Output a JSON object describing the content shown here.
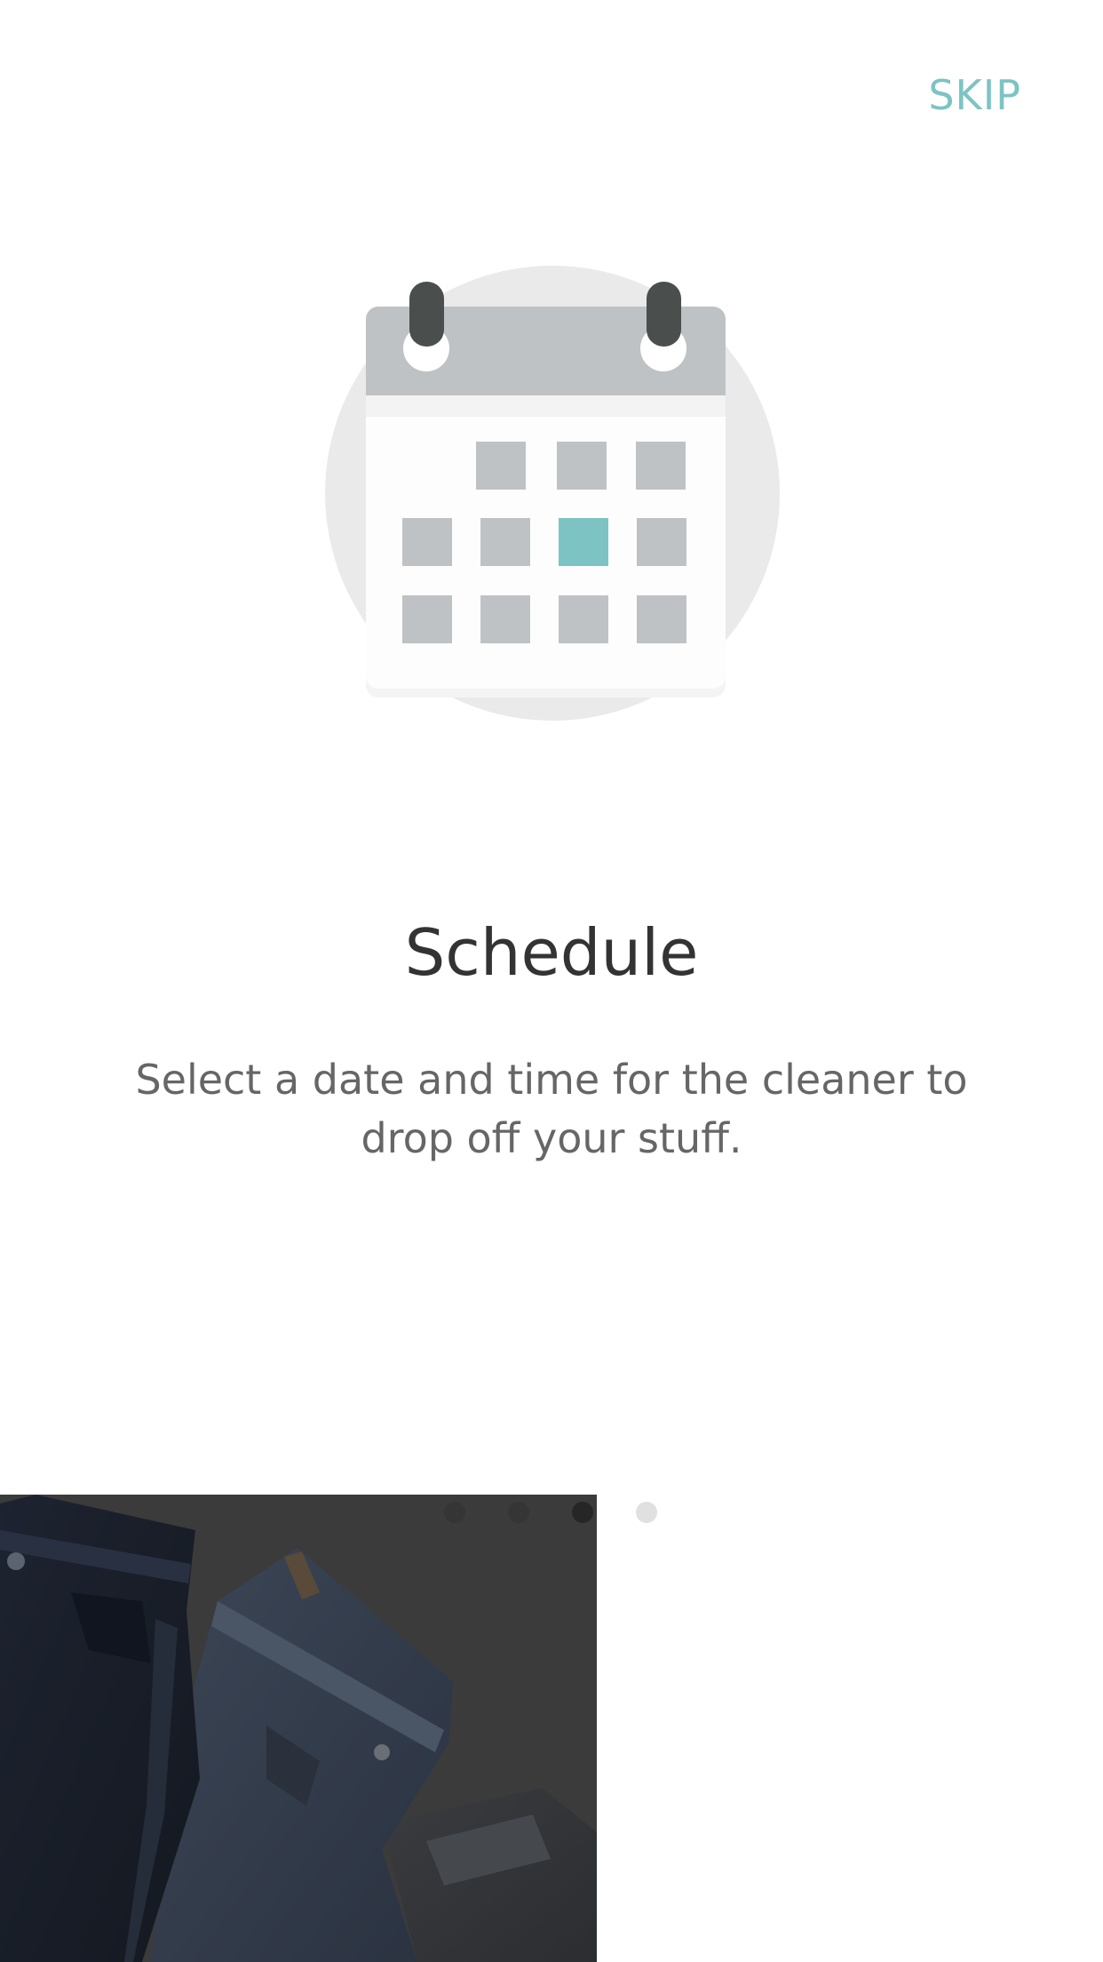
{
  "header": {
    "skip_label": "SKIP"
  },
  "slide": {
    "icon": "calendar-icon",
    "title": "Schedule",
    "subtitle": "Select a date and time for the cleaner to drop off your stuff."
  },
  "pager": {
    "total": 4,
    "current": 3
  },
  "colors": {
    "accent": "#7ec3c4",
    "title": "#333333",
    "subtitle": "#666666",
    "calendar_gray": "#bfc2c5",
    "ring_dark": "#4a4f4d",
    "circle_bg": "#eaeaea"
  },
  "background_image": "folded-jeans-photo"
}
